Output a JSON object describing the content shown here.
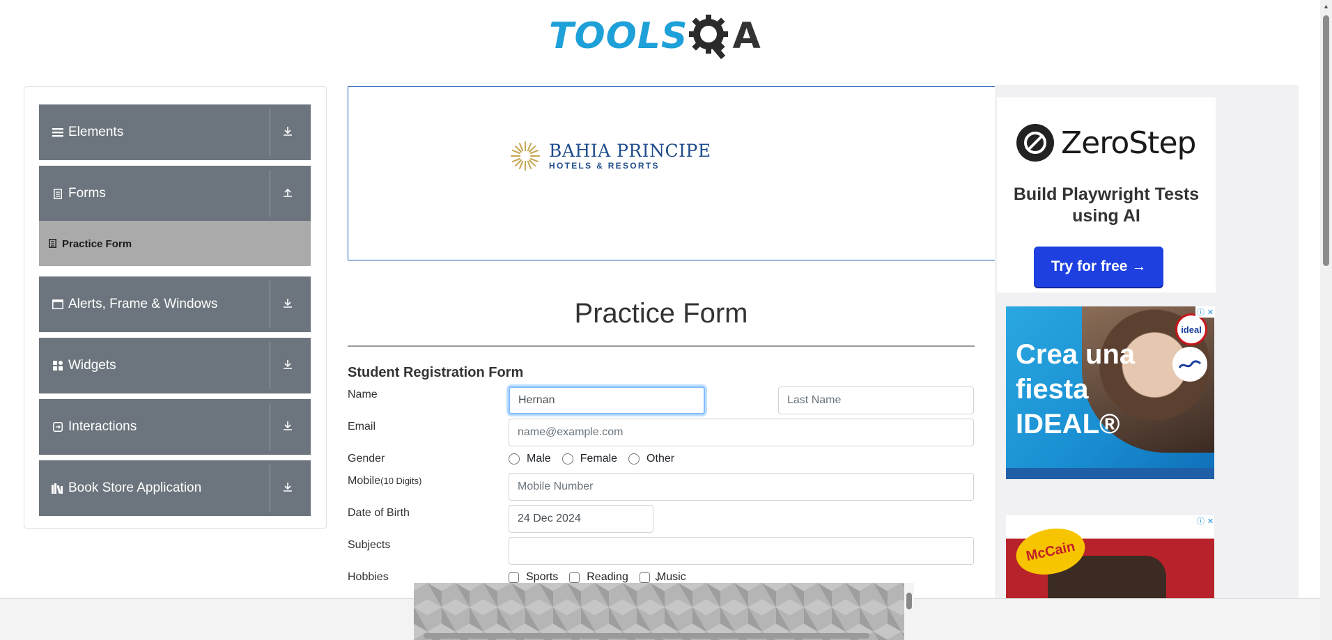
{
  "header": {
    "logo_text": "TOOLS",
    "logo_suffix": "A"
  },
  "sidebar": {
    "groups": [
      {
        "label": "Elements",
        "icon": "hamburger-icon"
      },
      {
        "label": "Forms",
        "icon": "document-icon"
      },
      {
        "label": "Alerts, Frame & Windows",
        "icon": "window-icon"
      },
      {
        "label": "Widgets",
        "icon": "grid-icon"
      },
      {
        "label": "Interactions",
        "icon": "interactions-icon"
      },
      {
        "label": "Book Store Application",
        "icon": "books-icon"
      }
    ],
    "active_item": {
      "label": "Practice Form",
      "icon": "form-icon"
    }
  },
  "banner": {
    "brand_line1": "BAHIA PRINCIPE",
    "brand_line2": "HOTELS & RESORTS"
  },
  "form": {
    "title": "Practice Form",
    "subtitle": "Student Registration Form",
    "name_label": "Name",
    "first_name_value": "Hernan",
    "last_name_placeholder": "Last Name",
    "email_label": "Email",
    "email_placeholder": "name@example.com",
    "gender_label": "Gender",
    "gender_options": [
      "Male",
      "Female",
      "Other"
    ],
    "mobile_label": "Mobile",
    "mobile_hint": "(10 Digits)",
    "mobile_placeholder": "Mobile Number",
    "dob_label": "Date of Birth",
    "dob_value": "24 Dec 2024",
    "subjects_label": "Subjects",
    "subjects_value": "",
    "hobbies_label": "Hobbies",
    "hobby_options": [
      "Sports",
      "Reading",
      "Music"
    ]
  },
  "ads": {
    "zerostep_name": "ZeroStep",
    "zerostep_tagline": "Build Playwright Tests using AI",
    "zerostep_button": "Try for free →",
    "ideal_text": "Crea una fiesta IDEAL®",
    "ideal_brand": "ideal",
    "mccain_brand": "McCain"
  },
  "colors": {
    "sidebar_group": "#6c757d",
    "active_item": "#aaaaaa",
    "logo_blue": "#1ea0d8",
    "cta_blue": "#1e40e0",
    "focus_border": "#80bdff"
  }
}
